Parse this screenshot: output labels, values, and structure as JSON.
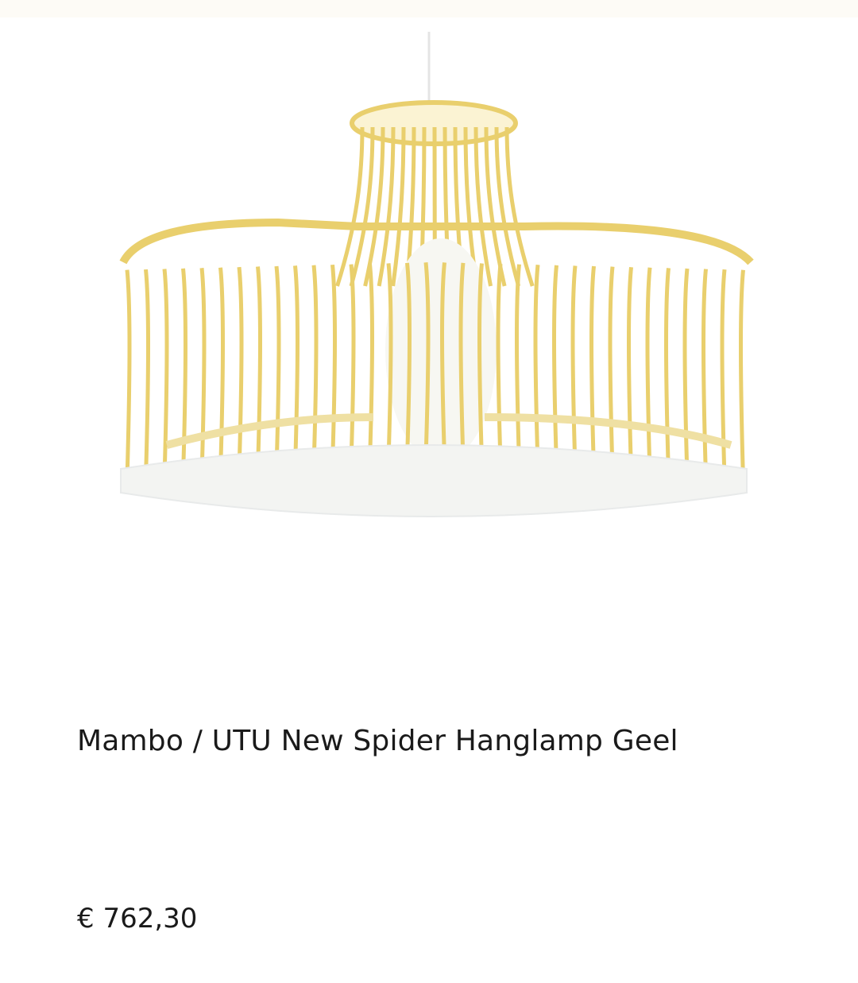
{
  "product": {
    "title": "Mambo / UTU New Spider Hanglamp Geel",
    "price": "€ 762,30",
    "image_icon": "pendant-lamp-image"
  },
  "colors": {
    "lamp_yellow": "#e9cf6d",
    "ring_white": "#f3f4f2",
    "text": "#1a1a1a"
  }
}
